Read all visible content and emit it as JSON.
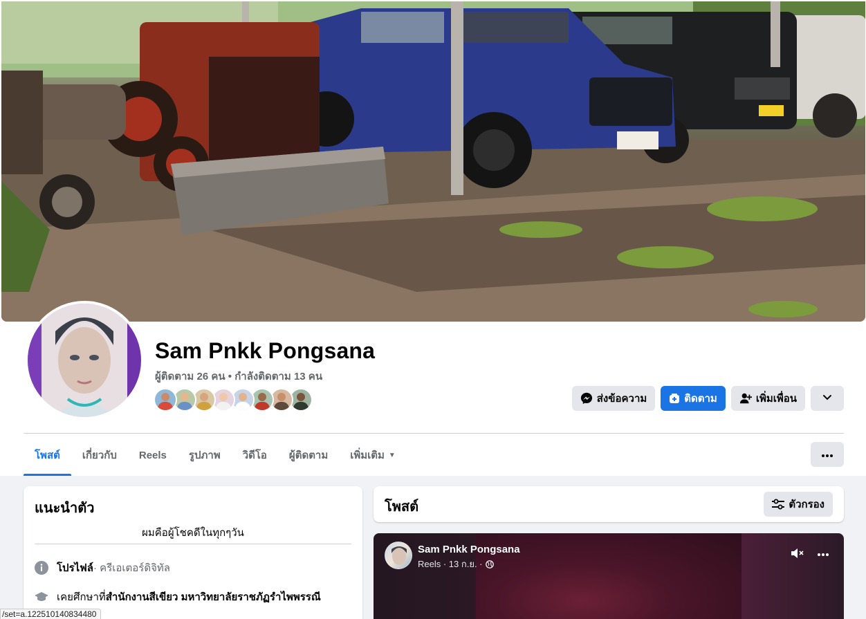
{
  "profile": {
    "name": "Sam Pnkk Pongsana",
    "stats": "ผู้ติดตาม 26 คน • กำลังติดตาม 13 คน"
  },
  "friends": [
    {
      "skin": "#c98b6b",
      "shirt": "#d84a3a"
    },
    {
      "skin": "#e5b68f",
      "shirt": "#6b8fc7"
    },
    {
      "skin": "#d7a57f",
      "shirt": "#cfa23e"
    },
    {
      "skin": "#f0c8a7",
      "shirt": "#f2f2f2"
    },
    {
      "skin": "#e3b38e",
      "shirt": "#ffffff"
    },
    {
      "skin": "#9a6a4b",
      "shirt": "#c0392b"
    },
    {
      "skin": "#c7906a",
      "shirt": "#5d4a3a"
    },
    {
      "skin": "#7a553e",
      "shirt": "#2f3b2e"
    }
  ],
  "actions": {
    "message": "ส่งข้อความ",
    "follow": "ติดตาม",
    "add_friend": "เพิ่มเพื่อน"
  },
  "tabs": {
    "posts": "โพสต์",
    "about": "เกี่ยวกับ",
    "reels": "Reels",
    "photos": "รูปภาพ",
    "videos": "วิดีโอ",
    "followers": "ผู้ติดตาม",
    "more": "เพิ่มเติม"
  },
  "intro": {
    "title": "แนะนำตัว",
    "bio": "ผมคือผู้โชคดีในทุกๆวัน",
    "profile_label": "โปรไฟล์",
    "profile_value": " · ครีเอเตอร์ดิจิทัล",
    "edu_prefix": "เคยศึกษาที่ ",
    "edu_value": "สำนักงานสีเขียว มหาวิทยาลัยราชภัฏรำไพพรรณี"
  },
  "posts": {
    "title": "โพสต์",
    "filter": "ตัวกรอง"
  },
  "post": {
    "author": "Sam Pnkk Pongsana",
    "meta": "Reels · 13 ก.ย. ·"
  },
  "status_url": "/set=a.122510140834480",
  "colors": {
    "accent": "#1b74e4",
    "secondary_button": "#e4e6eb",
    "muted_text": "#65676b"
  },
  "icons": {
    "message": "messenger-icon",
    "follow": "follow-icon",
    "add_friend": "add-friend-icon",
    "dropdown": "chevron-down-icon",
    "more": "more-dots-icon",
    "info": "info-icon",
    "education": "graduation-cap-icon",
    "filter": "filter-icon",
    "mute": "volume-muted-icon",
    "globe": "globe-icon"
  }
}
